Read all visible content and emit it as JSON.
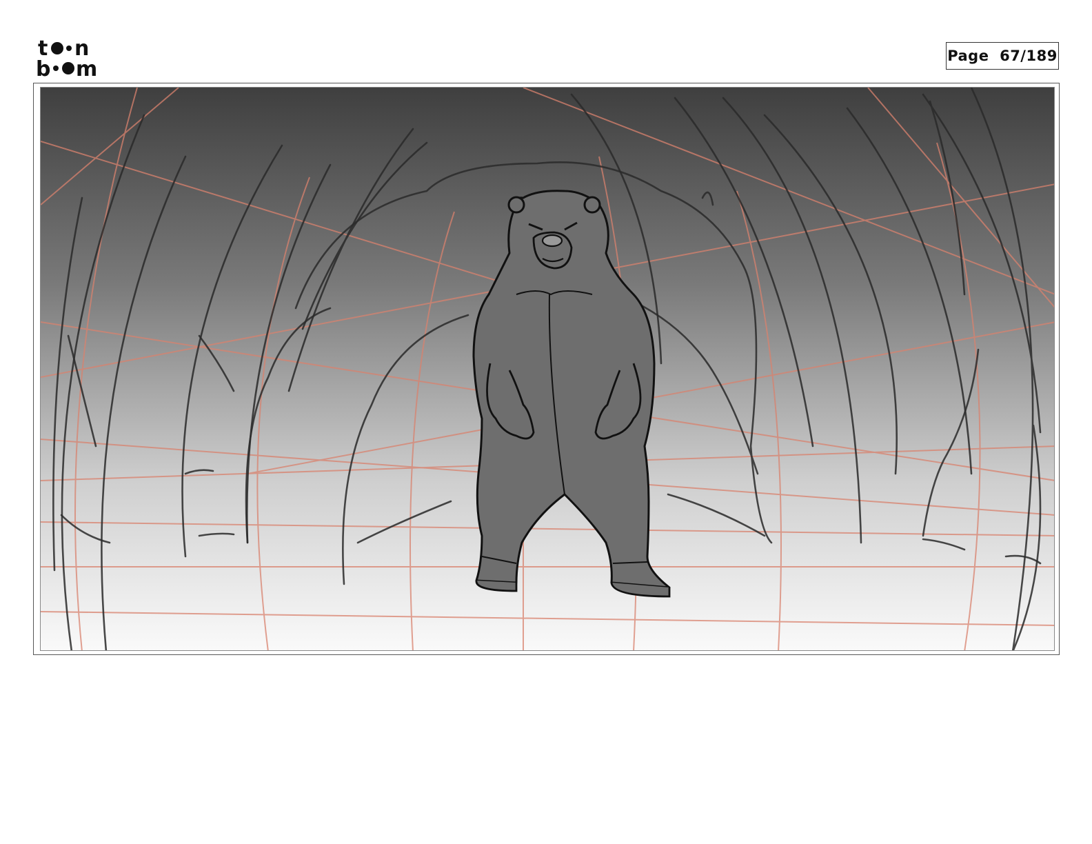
{
  "brand": {
    "logo_text_top": "toon",
    "logo_text_bottom": "boom",
    "icon": "toonboom-logo"
  },
  "header": {
    "page_label": "Page",
    "page_current": "67",
    "page_total": "189",
    "page_display": "Page  67/189"
  },
  "panel": {
    "illustration": "storyboard-sketch",
    "colors": {
      "sky_top": "#3f3f3f",
      "sky_bottom": "#fafafa",
      "sketch_line": "#2a2a2a",
      "guide_line": "#d9826e",
      "bear_fill": "#6e6e6e"
    }
  }
}
